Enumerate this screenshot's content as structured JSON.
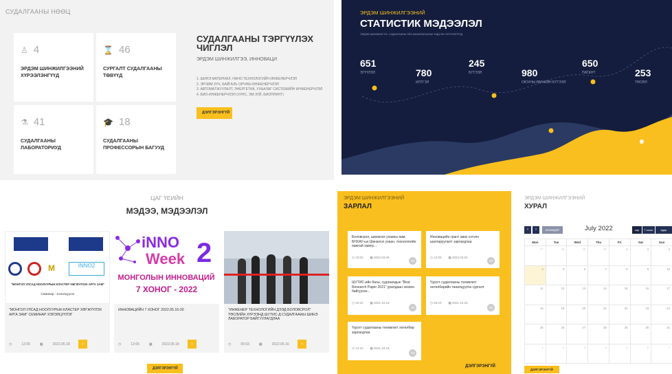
{
  "research": {
    "section_label": "СУДАЛГААНЫ НӨӨЦ",
    "cards": [
      {
        "icon": "person-icon",
        "glyph": "♙",
        "value": "4",
        "label": "ЭРДЭМ ШИНЖИЛГЭЭНИЙ ХҮРЭЭЛЭНГҮҮД"
      },
      {
        "icon": "hourglass-icon",
        "glyph": "⌛",
        "value": "46",
        "label": "СУРГАЛТ СУДАЛГААНЫ ТӨВҮҮД"
      },
      {
        "icon": "flask-icon",
        "glyph": "⚗",
        "value": "41",
        "label": "СУДАЛГААНЫ ЛАБОРАТОРИУД"
      },
      {
        "icon": "graduation-cap-icon",
        "glyph": "🎓",
        "value": "18",
        "label": "СУДАЛГААНЫ ПРОФЕССОРЫН БАГУУД"
      }
    ],
    "priority_title": "СУДАЛГААНЫ ТЭРГҮҮЛЭХ ЧИГЛЭЛ",
    "priority_subtitle": "ЭРДЭМ ШИНЖИЛГЭЭ, ИННОВАЦИ",
    "priority_list": [
      "1. ШИНЭ МАТЕРИАЛ, НАНО ТЕХНОЛОГИЙН ИНЖЕНЕРЧЛЭЛ",
      "2. ЭРЧИМ ХҮЧ, БАЙГАЛЬ ОРЧНЫ ИНЖЕНЕРЧЛЭЛ",
      "3. АВТОМАТЖУУЛАЛТ, ЭНЕРГЕТИК, УХААЛАГ СИСТЕМИЙН ИНЖЕНЕРЧЛЭЛ",
      "4. БИО-ИНЖЕНЕРЧЛЭЛ (ХҮНС, ЭМ ЗҮЙ, БИОПРИНТ)"
    ],
    "more_label": "ДЭЛГЭРЭНГҮЙ"
  },
  "stats": {
    "kicker": "ЭРДЭМ ШИНЖИЛГЭЭНИЙ",
    "title": "СТАТИСТИК МЭДЭЭЛЭЛ",
    "description": "ЭРДЭМ ШИНЖИЛГЭЭ, СУДАЛГААНЫ ҮЙЛ АЖИЛЛАГААНЫ ҮНДСЭН ҮЗҮҮЛЭЛТҮҮД",
    "items": [
      {
        "value": "651",
        "label": "ЭГҮҮЛЭЛ"
      },
      {
        "value": "780",
        "label": "ИЛТГЭЛ"
      },
      {
        "value": "245",
        "label": "БҮТЭЭЛ"
      },
      {
        "value": "980",
        "label": "ОЮУНЫ ӨМЧИЙН БҮТЭЭЛ"
      },
      {
        "value": "650",
        "label": "ПАТЕНТ"
      },
      {
        "value": "253",
        "label": "ТӨСӨЛ"
      }
    ]
  },
  "news": {
    "kicker": "ЦАГ ҮЕИЙН",
    "title": "МЭДЭЭ, МЭДЭЭЛЭЛ",
    "items": [
      {
        "caption": "\"МОНГОЛ УЛСАД НООЛУУРЫН КЛАСТЕР ХӨГЖҮҮЛЭХ АРГА ЗАМ\" СЕМИНАР ХЭЛЭЛЦҮҮЛЭГ",
        "views": "12:05",
        "date": "2022.05.18",
        "img_text": "\"МОНГОЛ УЛСАД НООЛУУРЫН КЛАСТЕР ХӨГЖҮҮЛЭХ АРГА ЗАМ\"",
        "img_sub": "Семинар - Хэлэлцүүлэг"
      },
      {
        "caption": "ИННОВАЦИЙН 7 ХОНОГ 2022.05.16-20",
        "views": "12:05",
        "date": "2022.05.18",
        "img_title1": "iNNO",
        "img_title2": "Week",
        "img_num": "2",
        "img_line1": "МОНГОЛЫН ИННОВАЦИЙ",
        "img_line2": "7 ХОНОГ - 2022"
      },
      {
        "caption": "\"ИНЖЕНЕР ТЕХНОЛОГИЙН ДЭЭД БОЛОВСРОЛ\" ТӨСЛИЙН ХҮРЭЭНД ШУТИС-Д СУДАЛГААНЫ ШИНЭ ЛАБОРАТОР БАЙГУУЛАГДЛАА",
        "views": "05:03",
        "date": "2022.05.16"
      }
    ],
    "more_label": "ДЭЛГЭРЭНГҮЙ"
  },
  "announcements": {
    "kicker": "ЭРДЭМ ШИНЖИЛГЭЭНИЙ",
    "title": "ЗАРЛАЛ",
    "items": [
      {
        "text": "Боловсрол, шинжлэх ухааны яам, БНХАУ-ын Шинжлэх ухаан, технологийн яамтай хамтр...",
        "time": "10:02",
        "date": "2022.03.09",
        "num": "33"
      },
      {
        "text": "Инновацийн грант авах хэтэлн шалгаруулалт зарлагдлаа",
        "time": "12:03",
        "date": "2022.03.04",
        "num": "33"
      },
      {
        "text": "ШУТИС-ийн багш, судлаачдын \"Best Research Paper 2021\" уралдаан зохион байгуулаг...",
        "time": "10:10",
        "date": "2021.10.15",
        "num": "33"
      },
      {
        "text": "Үүрэгт судалгааны төлөвлөгт хөтөлбөрийн танилцуулга сургалт",
        "time": "03:10",
        "date": "2021.10.15",
        "num": "33"
      },
      {
        "text": "Үүрэгт судалгааны төлөвлөгт хөтөлбөр зарлагдлаа",
        "time": "12:10",
        "date": "2021.10.18",
        "num": "33"
      }
    ],
    "more_label": "ДЭЛГЭРЭНГҮЙ"
  },
  "calendar": {
    "kicker": "ЭРДЭМ ШИНЖИЛГЭЭНИЙ",
    "title": "ХУРАЛ",
    "prev": "‹",
    "next": "›",
    "today_label": "ӨНӨӨДӨР",
    "month": "July 2022",
    "views": [
      "сар",
      "7 хоног",
      "өдөр"
    ],
    "weekdays": [
      "Mon",
      "Tue",
      "Wed",
      "Thu",
      "Fri",
      "Sat",
      "Sun"
    ],
    "weeks": [
      [
        "27",
        "28",
        "29",
        "30",
        "1",
        "2",
        "3"
      ],
      [
        "4",
        "5",
        "6",
        "7",
        "8",
        "9",
        "10"
      ],
      [
        "11",
        "12",
        "13",
        "14",
        "15",
        "16",
        "17"
      ],
      [
        "18",
        "19",
        "20",
        "21",
        "22",
        "23",
        "24"
      ],
      [
        "25",
        "26",
        "27",
        "28",
        "29",
        "30",
        "31"
      ],
      [
        "1",
        "2",
        "3",
        "4",
        "5",
        "6",
        "7"
      ]
    ],
    "more_label": "ДЭЛГЭРЭНГҮЙ"
  },
  "colors": {
    "accent": "#f9bf1e",
    "navy": "#141d3d"
  }
}
